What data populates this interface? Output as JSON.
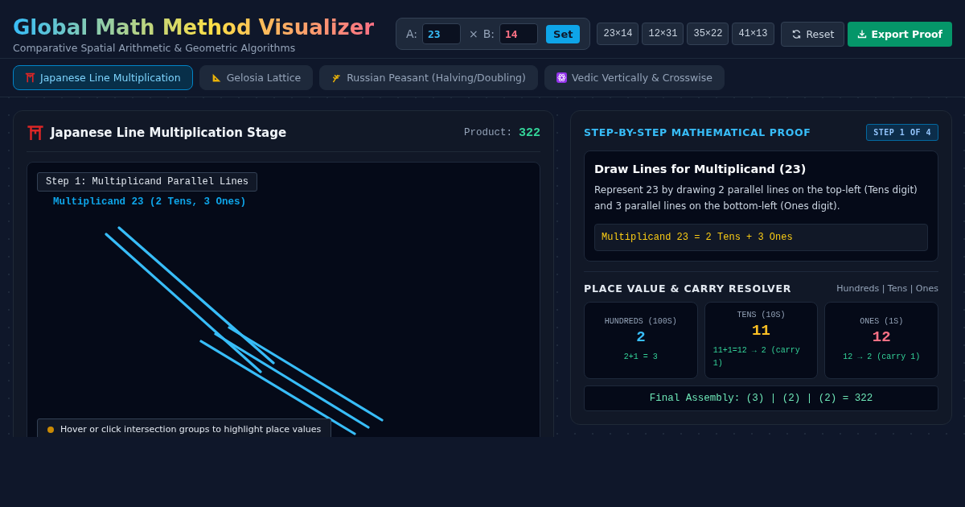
{
  "header": {
    "title": "Global Math Method Visualizer",
    "subtitle": "Comparative Spatial Arithmetic & Geometric Algorithms"
  },
  "inputs": {
    "a_label": "A:",
    "a_value": "23",
    "times": "×",
    "b_label": "B:",
    "b_value": "14",
    "set": "Set"
  },
  "presets": [
    "23×14",
    "12×31",
    "35×22",
    "41×13"
  ],
  "actions": {
    "reset": "Reset",
    "export": "Export Proof"
  },
  "tabs": [
    {
      "label": "Japanese Line Multiplication",
      "selected": true
    },
    {
      "label": "Gelosia Lattice",
      "selected": false
    },
    {
      "label": "Russian Peasant (Halving/Doubling)",
      "selected": false
    },
    {
      "label": "Vedic Vertically & Crosswise",
      "selected": false
    }
  ],
  "stage": {
    "title": "Japanese Line Multiplication Stage",
    "product_label": "Product:",
    "product": "322",
    "step_label": "Step 1: Multiplicand Parallel Lines",
    "caption": "Multiplicand 23 (2 Tens, 3 Ones)",
    "hint": "Hover or click intersection groups to highlight place values"
  },
  "proof": {
    "title": "STEP-BY-STEP MATHEMATICAL PROOF",
    "badge": "STEP 1 OF 4",
    "step_title": "Draw Lines for Multiplicand (23)",
    "step_text": "Represent 23 by drawing 2 parallel lines on the top-left (Tens digit) and 3 parallel lines on the bottom-left (Ones digit).",
    "formula": "Multiplicand 23 = 2 Tens + 3 Ones"
  },
  "resolver": {
    "title": "PLACE VALUE & CARRY RESOLVER",
    "legend": "Hundreds | Tens | Ones",
    "places": [
      {
        "label": "HUNDREDS (100S)",
        "value": "2",
        "note": "2+1 = 3",
        "color": "#38bdf8"
      },
      {
        "label": "TENS (10S)",
        "value": "11",
        "note": "11+1=12 → 2 (carry 1)",
        "color": "#fbbf24"
      },
      {
        "label": "ONES (1S)",
        "value": "12",
        "note": "12 → 2 (carry 1)",
        "color": "#fb7185"
      }
    ],
    "final": "Final Assembly: (3) | (2) | (2) = 322"
  }
}
